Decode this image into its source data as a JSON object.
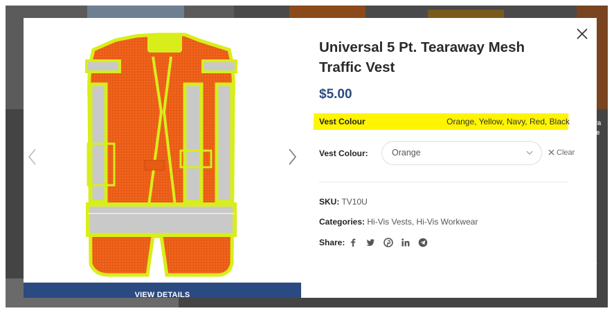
{
  "product": {
    "title": "Universal 5 Pt. Tearaway Mesh Traffic Vest",
    "price": "$5.00",
    "attribute": {
      "label": "Vest Colour",
      "value": "Orange, Yellow, Navy, Red, Black"
    },
    "variation": {
      "label": "Vest Colour:",
      "selected": "Orange",
      "clear_label": "Clear"
    },
    "sku": {
      "label": "SKU:",
      "value": "TV10U"
    },
    "categories": {
      "label": "Categories:",
      "items": [
        "Hi-Vis Vests",
        "Hi-Vis Workwear"
      ],
      "separator": ","
    },
    "share": {
      "label": "Share:",
      "icons": [
        "facebook-icon",
        "twitter-icon",
        "pinterest-icon",
        "linkedin-icon",
        "telegram-icon"
      ]
    }
  },
  "gallery": {
    "view_details_label": "VIEW DETAILS"
  },
  "background": {
    "right_text": "wa\nVe",
    "right_letter": "R"
  },
  "colors": {
    "accent": "#2b4a82",
    "highlight": "#fff500",
    "vest_orange": "#f0621a",
    "vest_yellow": "#d8ee1a"
  }
}
